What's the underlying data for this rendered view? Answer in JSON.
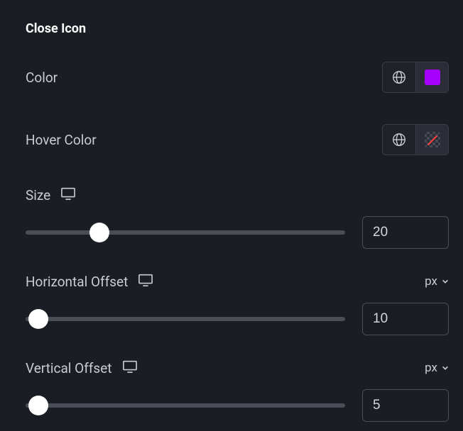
{
  "section": {
    "title": "Close Icon"
  },
  "color": {
    "label": "Color",
    "value": "#a600ff"
  },
  "hoverColor": {
    "label": "Hover Color",
    "value": null
  },
  "size": {
    "label": "Size",
    "value": "20",
    "sliderPercent": 23
  },
  "hOffset": {
    "label": "Horizontal Offset",
    "unit": "px",
    "value": "10",
    "sliderPercent": 4
  },
  "vOffset": {
    "label": "Vertical Offset",
    "unit": "px",
    "value": "5",
    "sliderPercent": 4
  }
}
